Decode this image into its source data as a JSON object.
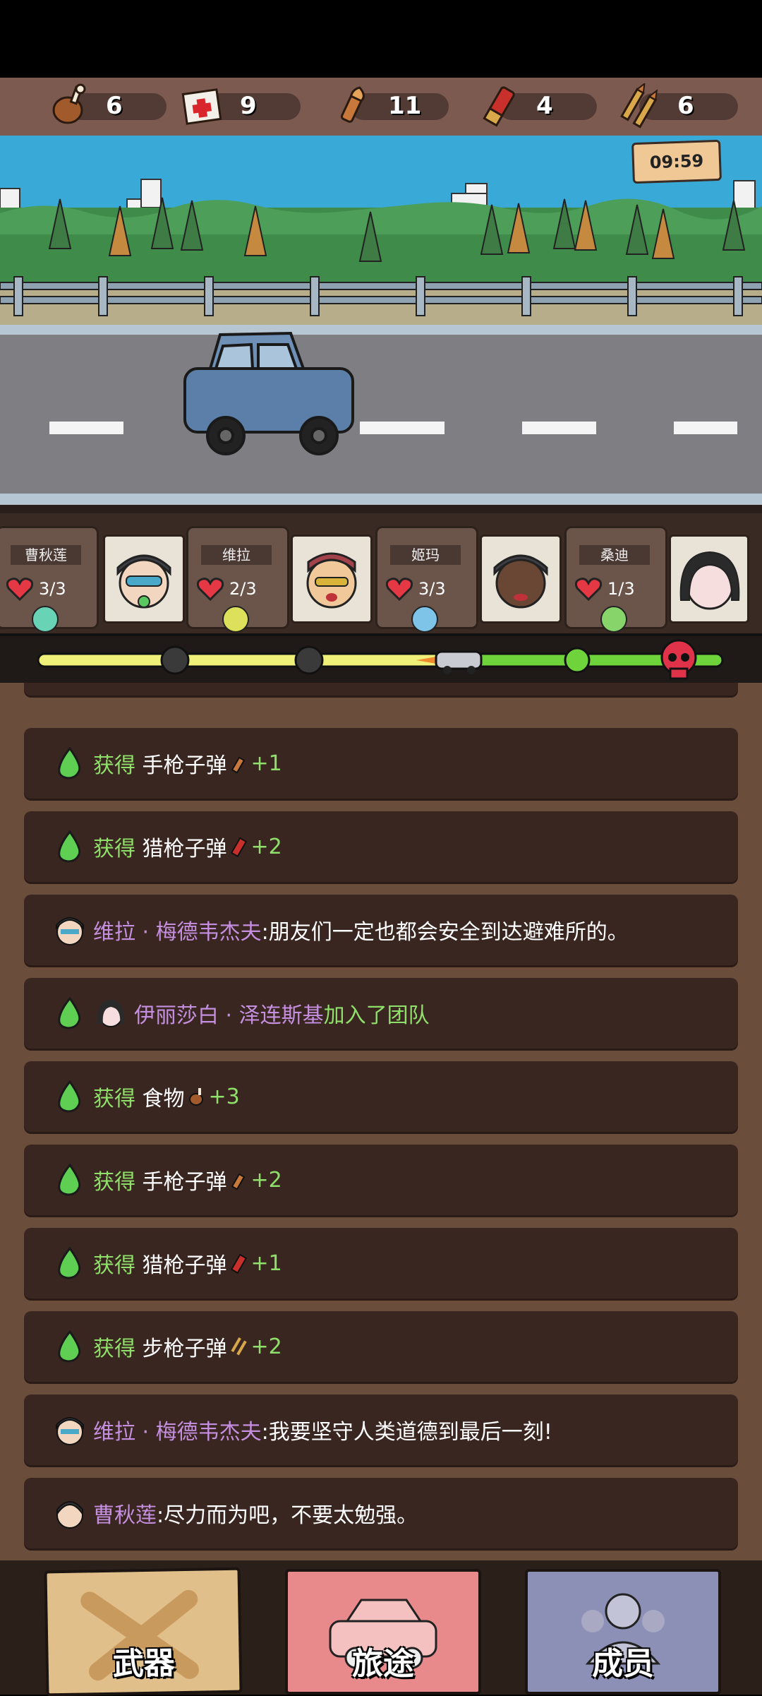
{
  "resources": {
    "food": {
      "icon": "drumstick-icon",
      "value": "6"
    },
    "medkit": {
      "icon": "medkit-icon",
      "value": "9"
    },
    "pistol_ammo": {
      "icon": "pistol-bullet-icon",
      "value": "11"
    },
    "shotgun_ammo": {
      "icon": "shotgun-shell-icon",
      "value": "4"
    },
    "rifle_ammo": {
      "icon": "rifle-bullets-icon",
      "value": "6"
    }
  },
  "timer": "09:59",
  "party": [
    {
      "name": "曹秋莲",
      "hp": "3/3",
      "mood": "neutral",
      "mood_color": "#69d3b6"
    },
    {
      "name": "维拉",
      "hp": "2/3",
      "mood": "grin",
      "mood_color": "#dde05a"
    },
    {
      "name": "姬玛",
      "hp": "3/3",
      "mood": "sad",
      "mood_color": "#7ec4e8"
    },
    {
      "name": "桑迪",
      "hp": "1/3",
      "mood": "happy",
      "mood_color": "#87d56a"
    }
  ],
  "log": [
    {
      "type": "gain",
      "prefix": "获得",
      "item": "手枪子弹",
      "icon": "pistol-bullet-icon",
      "amount": "+1"
    },
    {
      "type": "gain",
      "prefix": "获得",
      "item": "猎枪子弹",
      "icon": "shotgun-shell-icon",
      "amount": "+2"
    },
    {
      "type": "speech",
      "speaker": "维拉 · 梅德韦杰夫",
      "text": ":朋友们一定也都会安全到达避难所的。"
    },
    {
      "type": "join",
      "member": "伊丽莎白 · 泽连斯基",
      "text": " 加入了团队"
    },
    {
      "type": "gain",
      "prefix": "获得",
      "item": "食物",
      "icon": "drumstick-icon",
      "amount": "+3"
    },
    {
      "type": "gain",
      "prefix": "获得",
      "item": "手枪子弹",
      "icon": "pistol-bullet-icon",
      "amount": "+2"
    },
    {
      "type": "gain",
      "prefix": "获得",
      "item": "猎枪子弹",
      "icon": "shotgun-shell-icon",
      "amount": "+1"
    },
    {
      "type": "gain",
      "prefix": "获得",
      "item": "步枪子弹",
      "icon": "rifle-bullets-icon",
      "amount": "+2"
    },
    {
      "type": "speech",
      "speaker": "维拉 · 梅德韦杰夫",
      "text": ":我要坚守人类道德到最后一刻!"
    },
    {
      "type": "speech",
      "speaker": "曹秋莲",
      "text": ":尽力而为吧，不要太勉强。"
    }
  ],
  "nav": {
    "weapons": "武器",
    "journey": "旅途",
    "members": "成员"
  },
  "colors": {
    "gain_green": "#8fe06a",
    "name_purple": "#c58fe0",
    "progress_yellow": "#eef07a",
    "progress_green": "#6fd43c",
    "skull_red": "#e0334a"
  }
}
